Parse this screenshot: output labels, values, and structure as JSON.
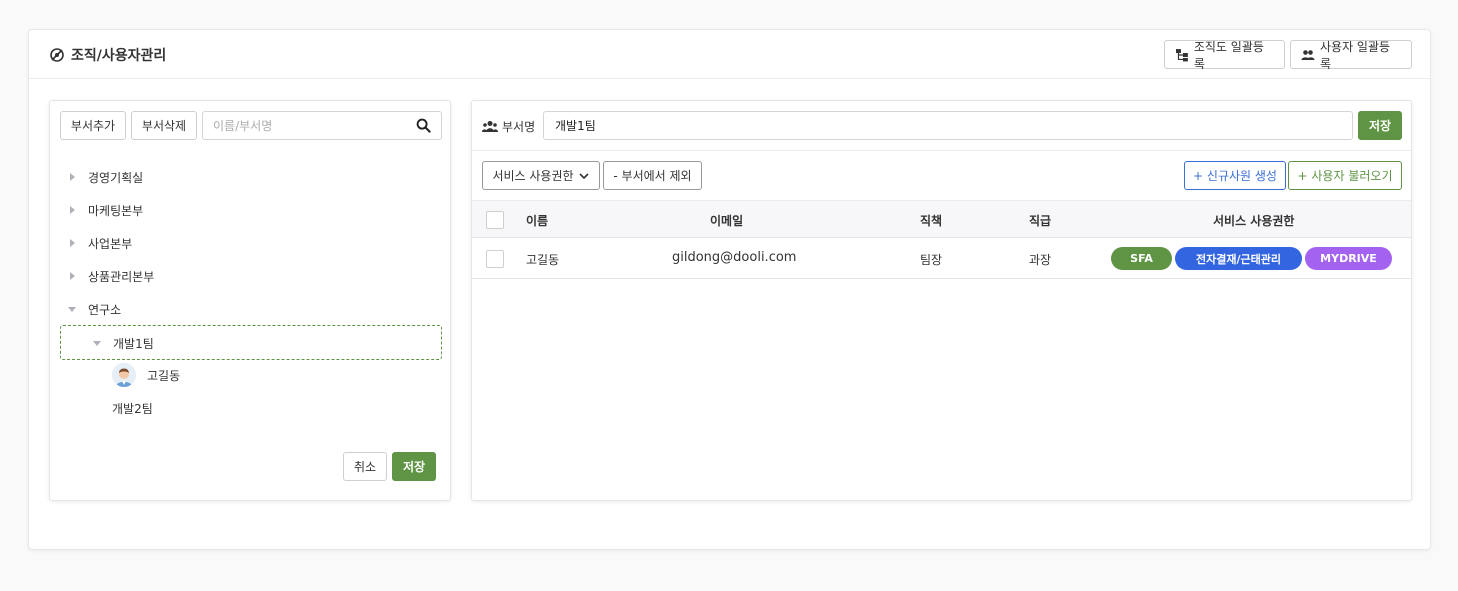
{
  "header": {
    "title": "조직/사용자관리",
    "org_bulk_label": "조직도 일괄등록",
    "user_bulk_label": "사용자 일괄등록"
  },
  "left": {
    "add_dept_label": "부서추가",
    "delete_dept_label": "부서삭제",
    "search_placeholder": "이름/부서명",
    "tree": [
      "경영기획실",
      "마케팅본부",
      "사업본부",
      "상품관리본부",
      "연구소"
    ],
    "team1": "개발1팀",
    "member": "고길동",
    "team2": "개발2팀",
    "cancel_label": "취소",
    "save_label": "저장"
  },
  "right": {
    "dept_label": "부서명",
    "dept_value": "개발1팀",
    "save_label": "저장",
    "service_perm_label": "서비스 사용권한",
    "exclude_label": "- 부서에서 제외",
    "new_employee_label": "+ 신규사원 생성",
    "load_user_label": "+ 사용자 불러오기",
    "columns": [
      "이름",
      "이메일",
      "직책",
      "직급",
      "서비스 사용권한"
    ],
    "rows": [
      {
        "name": "고길동",
        "email": "gildong@dooli.com",
        "position": "팀장",
        "rank": "과장",
        "services": [
          "SFA",
          "전자결재/근태관리",
          "MYDRIVE"
        ]
      }
    ]
  },
  "colors": {
    "primary_green": "#5e9444",
    "sfa": "#5e9444",
    "approval": "#3465e0",
    "mydrive": "#a362f0",
    "blue_outline": "#3b6fd6"
  }
}
